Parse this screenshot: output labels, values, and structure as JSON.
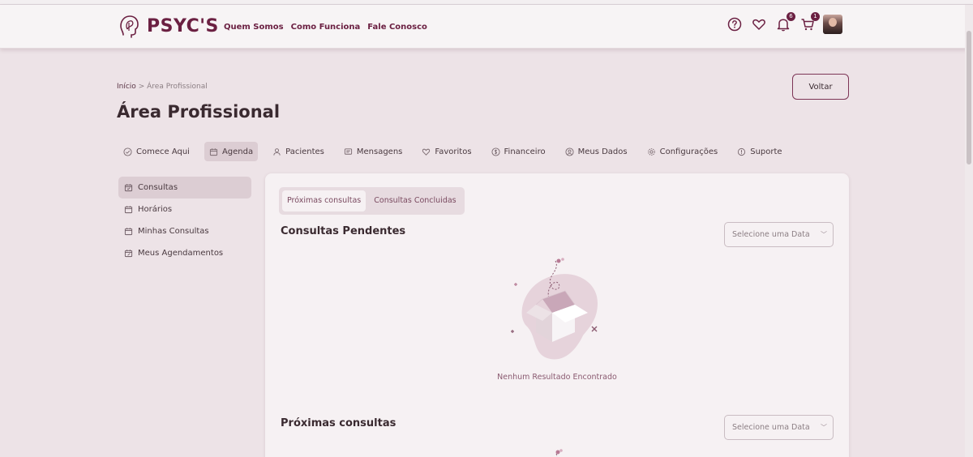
{
  "brand": {
    "name": "PSYC'S"
  },
  "nav": [
    "Quem Somos",
    "Como Funciona",
    "Fale Conosco"
  ],
  "header_icons": [
    {
      "name": "help-icon"
    },
    {
      "name": "heart-icon"
    },
    {
      "name": "bell-icon",
      "badge": "6"
    },
    {
      "name": "cart-icon",
      "badge": "1"
    }
  ],
  "breadcrumb": {
    "home": "Início",
    "separator": ">",
    "current": "Área Profissional"
  },
  "page_title": "Área Profissional",
  "back_button": "Voltar",
  "tabs": [
    {
      "label": "Comece Aqui",
      "icon": "check-circle-icon"
    },
    {
      "label": "Agenda",
      "icon": "calendar-icon",
      "active": true
    },
    {
      "label": "Pacientes",
      "icon": "user-icon"
    },
    {
      "label": "Mensagens",
      "icon": "message-icon"
    },
    {
      "label": "Favoritos",
      "icon": "heart-icon"
    },
    {
      "label": "Financeiro",
      "icon": "dollar-icon"
    },
    {
      "label": "Meus Dados",
      "icon": "user-circle-icon"
    },
    {
      "label": "Configurações",
      "icon": "gear-icon"
    },
    {
      "label": "Suporte",
      "icon": "support-icon"
    }
  ],
  "sidebar": [
    {
      "label": "Consultas",
      "icon": "calendar-check-icon",
      "active": true
    },
    {
      "label": "Horários",
      "icon": "calendar-icon"
    },
    {
      "label": "Minhas Consultas",
      "icon": "calendar-icon"
    },
    {
      "label": "Meus Agendamentos",
      "icon": "calendar-edit-icon"
    }
  ],
  "subtabs": [
    {
      "label": "Próximas consultas",
      "active": true
    },
    {
      "label": "Consultas Concluidas"
    }
  ],
  "sections": {
    "pending": {
      "title": "Consultas Pendentes",
      "select_placeholder": "Selecione uma Data",
      "empty_text": "Nenhum Resultado Encontrado"
    },
    "upcoming": {
      "title": "Próximas consultas",
      "select_placeholder": "Selecione uma Data"
    }
  },
  "colors": {
    "brand": "#6b2042",
    "background": "#ede3e7",
    "panel": "#f6f1f3",
    "active": "#dccdd3"
  }
}
